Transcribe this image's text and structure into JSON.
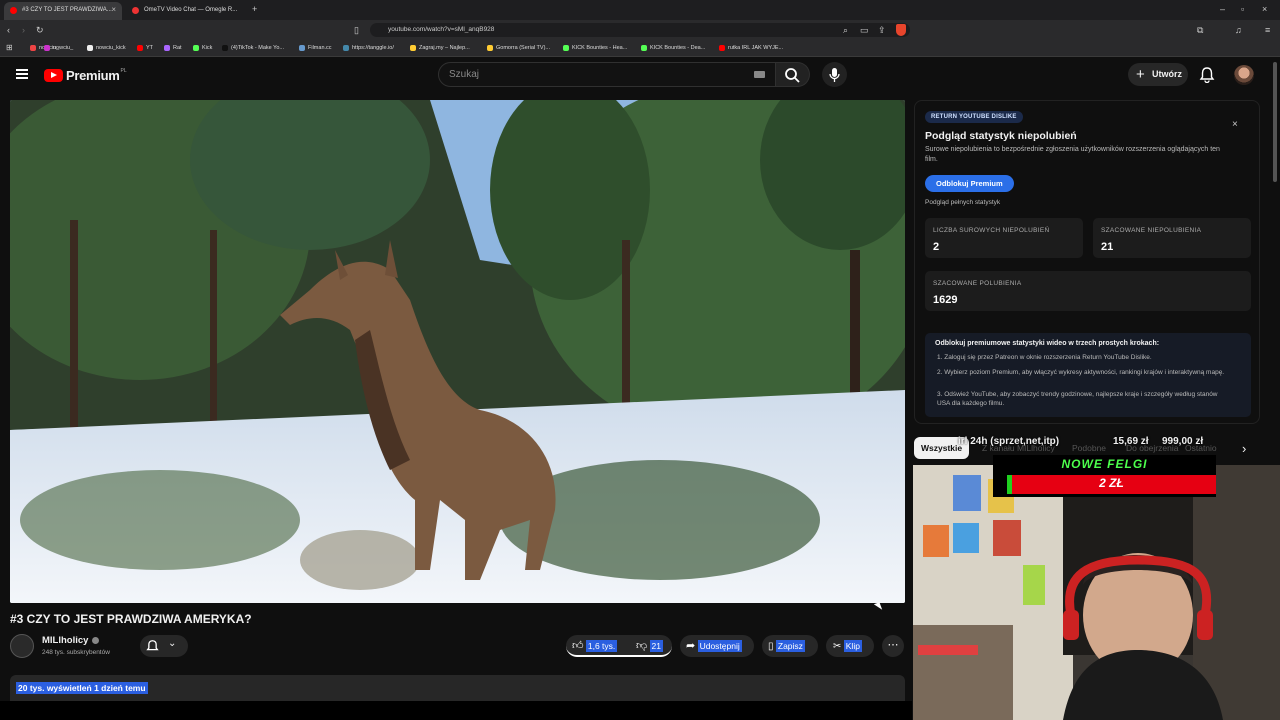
{
  "browser": {
    "tabs": [
      {
        "label": "#3 CZY TO JEST PRAWDZIWA...",
        "active": true
      },
      {
        "label": "OmeTV Video Chat — Omegle R...",
        "active": false
      }
    ],
    "url": "youtube.com/watch?v=sMl_anqB928",
    "bookmarks": [
      "nowciu_",
      "nowciu_kick",
      "YT",
      "Rat",
      "Kick",
      "(4)TikTok - Make Yo...",
      "Filman.cc",
      "https://tanggle.io/",
      "Zagraj.my – Najlep...",
      "Gomorra (Serial TV)...",
      "KICK Bounties - Hea...",
      "KICK Bounties - Dea...",
      "rutka IRL JAK WYJE..."
    ]
  },
  "youtube": {
    "logo_text": "Premium",
    "logo_region": "PL",
    "search_placeholder": "Szukaj",
    "create_label": "Utwórz"
  },
  "video": {
    "title": "#3 CZY TO JEST PRAWDZIWA AMERYKA?",
    "channel": "MILlholicy",
    "subscribers": "248 tys. subskrybentów",
    "likes": "1,6 tys.",
    "dislikes": "21",
    "share": "Udostępnij",
    "save": "Zapisz",
    "clip": "Klip",
    "views_line": "20 tys. wyświetleń  1 dzień temu"
  },
  "ryd": {
    "badge": "RETURN YOUTUBE DISLIKE",
    "title": "Podgląd statystyk niepolubień",
    "desc": "Surowe niepolubienia to bezpośrednie zgłoszenia użytkowników rozszerzenia oglądających ten film.",
    "unlock_button": "Odblokuj Premium",
    "preview_link": "Podgląd pełnych statystyk",
    "cards": [
      {
        "label": "LICZBA SUROWYCH NIEPOLUBIEŃ",
        "value": "2"
      },
      {
        "label": "SZACOWANE NIEPOLUBIENIA",
        "value": "21"
      },
      {
        "label": "SZACOWANE POLUBIENIA",
        "value": "1629"
      }
    ],
    "steps_title": "Odblokuj premiumowe statystyki wideo w trzech prostych krokach:",
    "steps": [
      "1.  Zaloguj się przez Patreon w oknie rozszerzenia Return YouTube Dislike.",
      "2.  Wybierz poziom Premium, aby włączyć wykresy aktywności, rankingi krajów i interaktywną mapę.",
      "3.  Odśwież YouTube, aby zobaczyć trendy godzinowe, najlepsze kraje i szczegóły według stanów USA dla każdego filmu."
    ]
  },
  "chips": {
    "first": "Wszystkie",
    "others": [
      "Z kanału MILlholicy",
      "Podobne",
      "Do obejrzenia",
      "Ostatnio"
    ]
  },
  "overlay": {
    "ticker": "irl 24h (sprzet,net,itp)",
    "amount_current": "15,69 zł",
    "amount_goal": "999,00 zł",
    "banner_title": "NOWE FELGI",
    "banner_value": "2 ZŁ"
  },
  "colors": {
    "accent": "#2b5fe0",
    "youtube_red": "#ff0000",
    "banner_red": "#e60012",
    "banner_green": "#1fd11f"
  }
}
